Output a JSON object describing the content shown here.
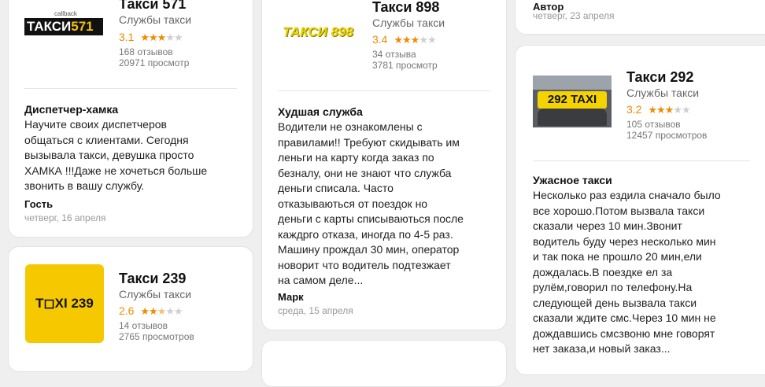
{
  "cards": {
    "c571": {
      "name": "Такси 571",
      "category": "Службы такси",
      "rating": "3.1",
      "stars_filled": 3,
      "reviews": "168 отзывов",
      "views": "20971 просмотр",
      "logo_main": "ТАКСИ",
      "logo_num": "571",
      "logo_small": "callback",
      "review_title": "Диспетчер-хамка",
      "review_text": "Научите своих диспетчеров\nобщаться с клиентами. Сегодня\nвызывала такси, девушка просто\nХАМКА !!!Даже не хочеться больше\nзвонить в вашу службу.",
      "author": "Гость",
      "date": "четверг, 16 апреля"
    },
    "c898": {
      "name": "Такси 898",
      "category": "Службы такси",
      "rating": "3.4",
      "stars_filled": 3,
      "reviews": "34 отзыва",
      "views": "3781 просмотр",
      "logo_text": "ТАКСИ 898",
      "review_title": "Худшая служба",
      "review_text": "Водители не ознакомлены с\nправилами!! Требуют скидывать им\nленьги на карту когда заказ по\nбезналу, они не знают что служба\nденьги списала. Часто\nотказываються от поездок но\nденьги с карты списываються после\nкаждрго отказа, иногда по 4-5 раз.\nМашину прождал 30 мин, оператор\nноворит что водитель подтезжает\nна самом деле...",
      "author": "Марк",
      "date": "среда, 15 апреля"
    },
    "top_right": {
      "author": "Автор",
      "date": "четверг, 23 апреля"
    },
    "c292": {
      "name": "Такси 292",
      "category": "Службы такси",
      "rating": "3.2",
      "stars_filled": 3,
      "reviews": "105 отзывов",
      "views": "12457 просмотров",
      "logo_text": "292 TAXI",
      "review_title": "Ужасное такси",
      "review_text": "Несколько раз ездила сначало было\nвсе хорошо.Потом вызвала такси\nсказали через 10 мин.Звонит\nводитель буду через несколько мин\nи так пока не прошло 20 мин,ели\nдождалась.В поездке ел за\nрулём,говорил по телефону.На\nследующей день вызвала такси\nсказали ждите смс.Через 10 мин не\nдождавшись смсзвоню мне говорят\nнет заказа,и новый заказ..."
    },
    "c239": {
      "name": "Такси 239",
      "category": "Службы такси",
      "rating": "2.6",
      "stars_filled": 2,
      "reviews": "14 отзывов",
      "views": "2765 просмотров",
      "logo_text": "T◻XI 239"
    }
  },
  "colors": {
    "accent": "#f08a00",
    "star_off": "#cfcfcf",
    "background": "#efefef"
  }
}
